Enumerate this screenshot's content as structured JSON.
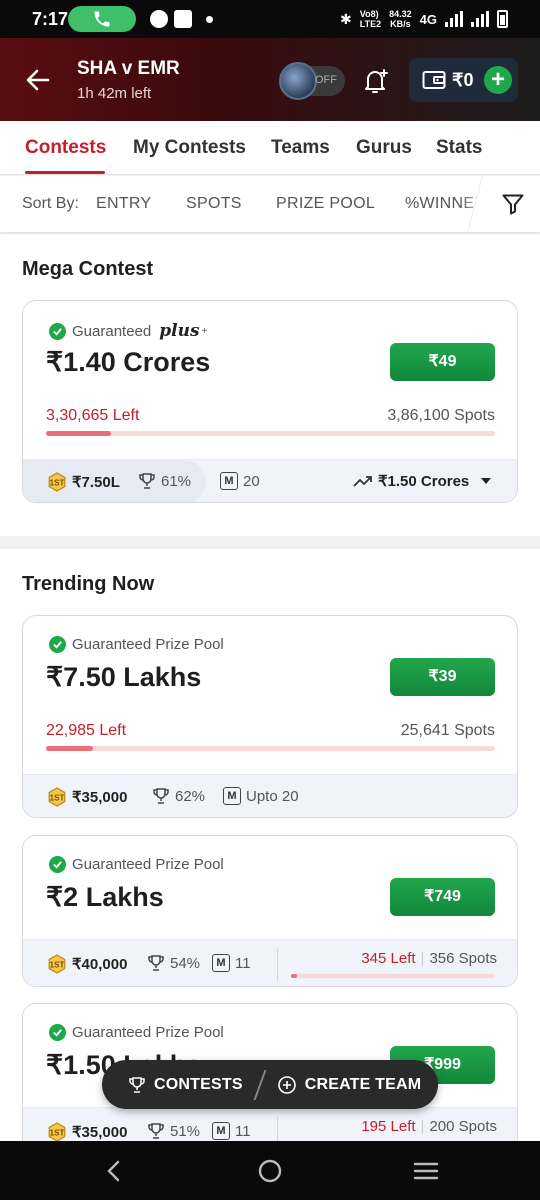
{
  "status_bar": {
    "time": "7:17",
    "net_top": "Vo8)",
    "net_bottom": "LTE2",
    "speed_value": "84.32",
    "speed_unit": "KB/s",
    "network": "4G"
  },
  "header": {
    "match_title": "SHA v EMR",
    "time_left": "1h 42m left",
    "toggle_label": "OFF",
    "wallet_amount": "₹0",
    "wallet_add": "+"
  },
  "tabs": [
    "Contests",
    "My Contests",
    "Teams",
    "Gurus",
    "Stats"
  ],
  "sort": {
    "label": "Sort By:",
    "options": [
      "ENTRY",
      "SPOTS",
      "PRIZE POOL",
      "%WINNERS"
    ]
  },
  "mega": {
    "section_title": "Mega Contest",
    "contest": {
      "guarantee": "Guaranteed",
      "guarantee_suffix": "plus",
      "prize": "₹1.40 Crores",
      "entry": "₹49",
      "left": "3,30,665 Left",
      "spots": "3,86,100 Spots",
      "fill_fraction": 0.144,
      "first_prize": "₹7.50L",
      "win_pct": "61%",
      "max_teams": "20",
      "max_prize": "₹1.50 Crores"
    }
  },
  "trending": {
    "section_title": "Trending Now",
    "contests": [
      {
        "guarantee": "Guaranteed Prize Pool",
        "prize": "₹7.50 Lakhs",
        "entry": "₹39",
        "left": "22,985 Left",
        "spots": "25,641 Spots",
        "fill_fraction": 0.104,
        "first_prize": "₹35,000",
        "win_pct": "62%",
        "max_teams": "Upto 20"
      },
      {
        "guarantee": "Guaranteed Prize Pool",
        "prize": "₹2 Lakhs",
        "entry": "₹749",
        "left": "345 Left",
        "spots": "356 Spots",
        "fill_fraction": 0.031,
        "first_prize": "₹40,000",
        "win_pct": "54%",
        "max_teams": "11"
      },
      {
        "guarantee": "Guaranteed Prize Pool",
        "prize": "₹1.50 Lakhs",
        "entry": "₹999",
        "left": "195 Left",
        "spots": "200 Spots",
        "fill_fraction": 0.025,
        "first_prize": "₹35,000",
        "win_pct": "51%",
        "max_teams": "11"
      }
    ]
  },
  "fab": {
    "contests_label": "CONTESTS",
    "create_team_label": "CREATE TEAM"
  },
  "colors": {
    "brand_red": "#c41e2c",
    "green": "#1fa84a",
    "dark": "#2a2a2a"
  }
}
